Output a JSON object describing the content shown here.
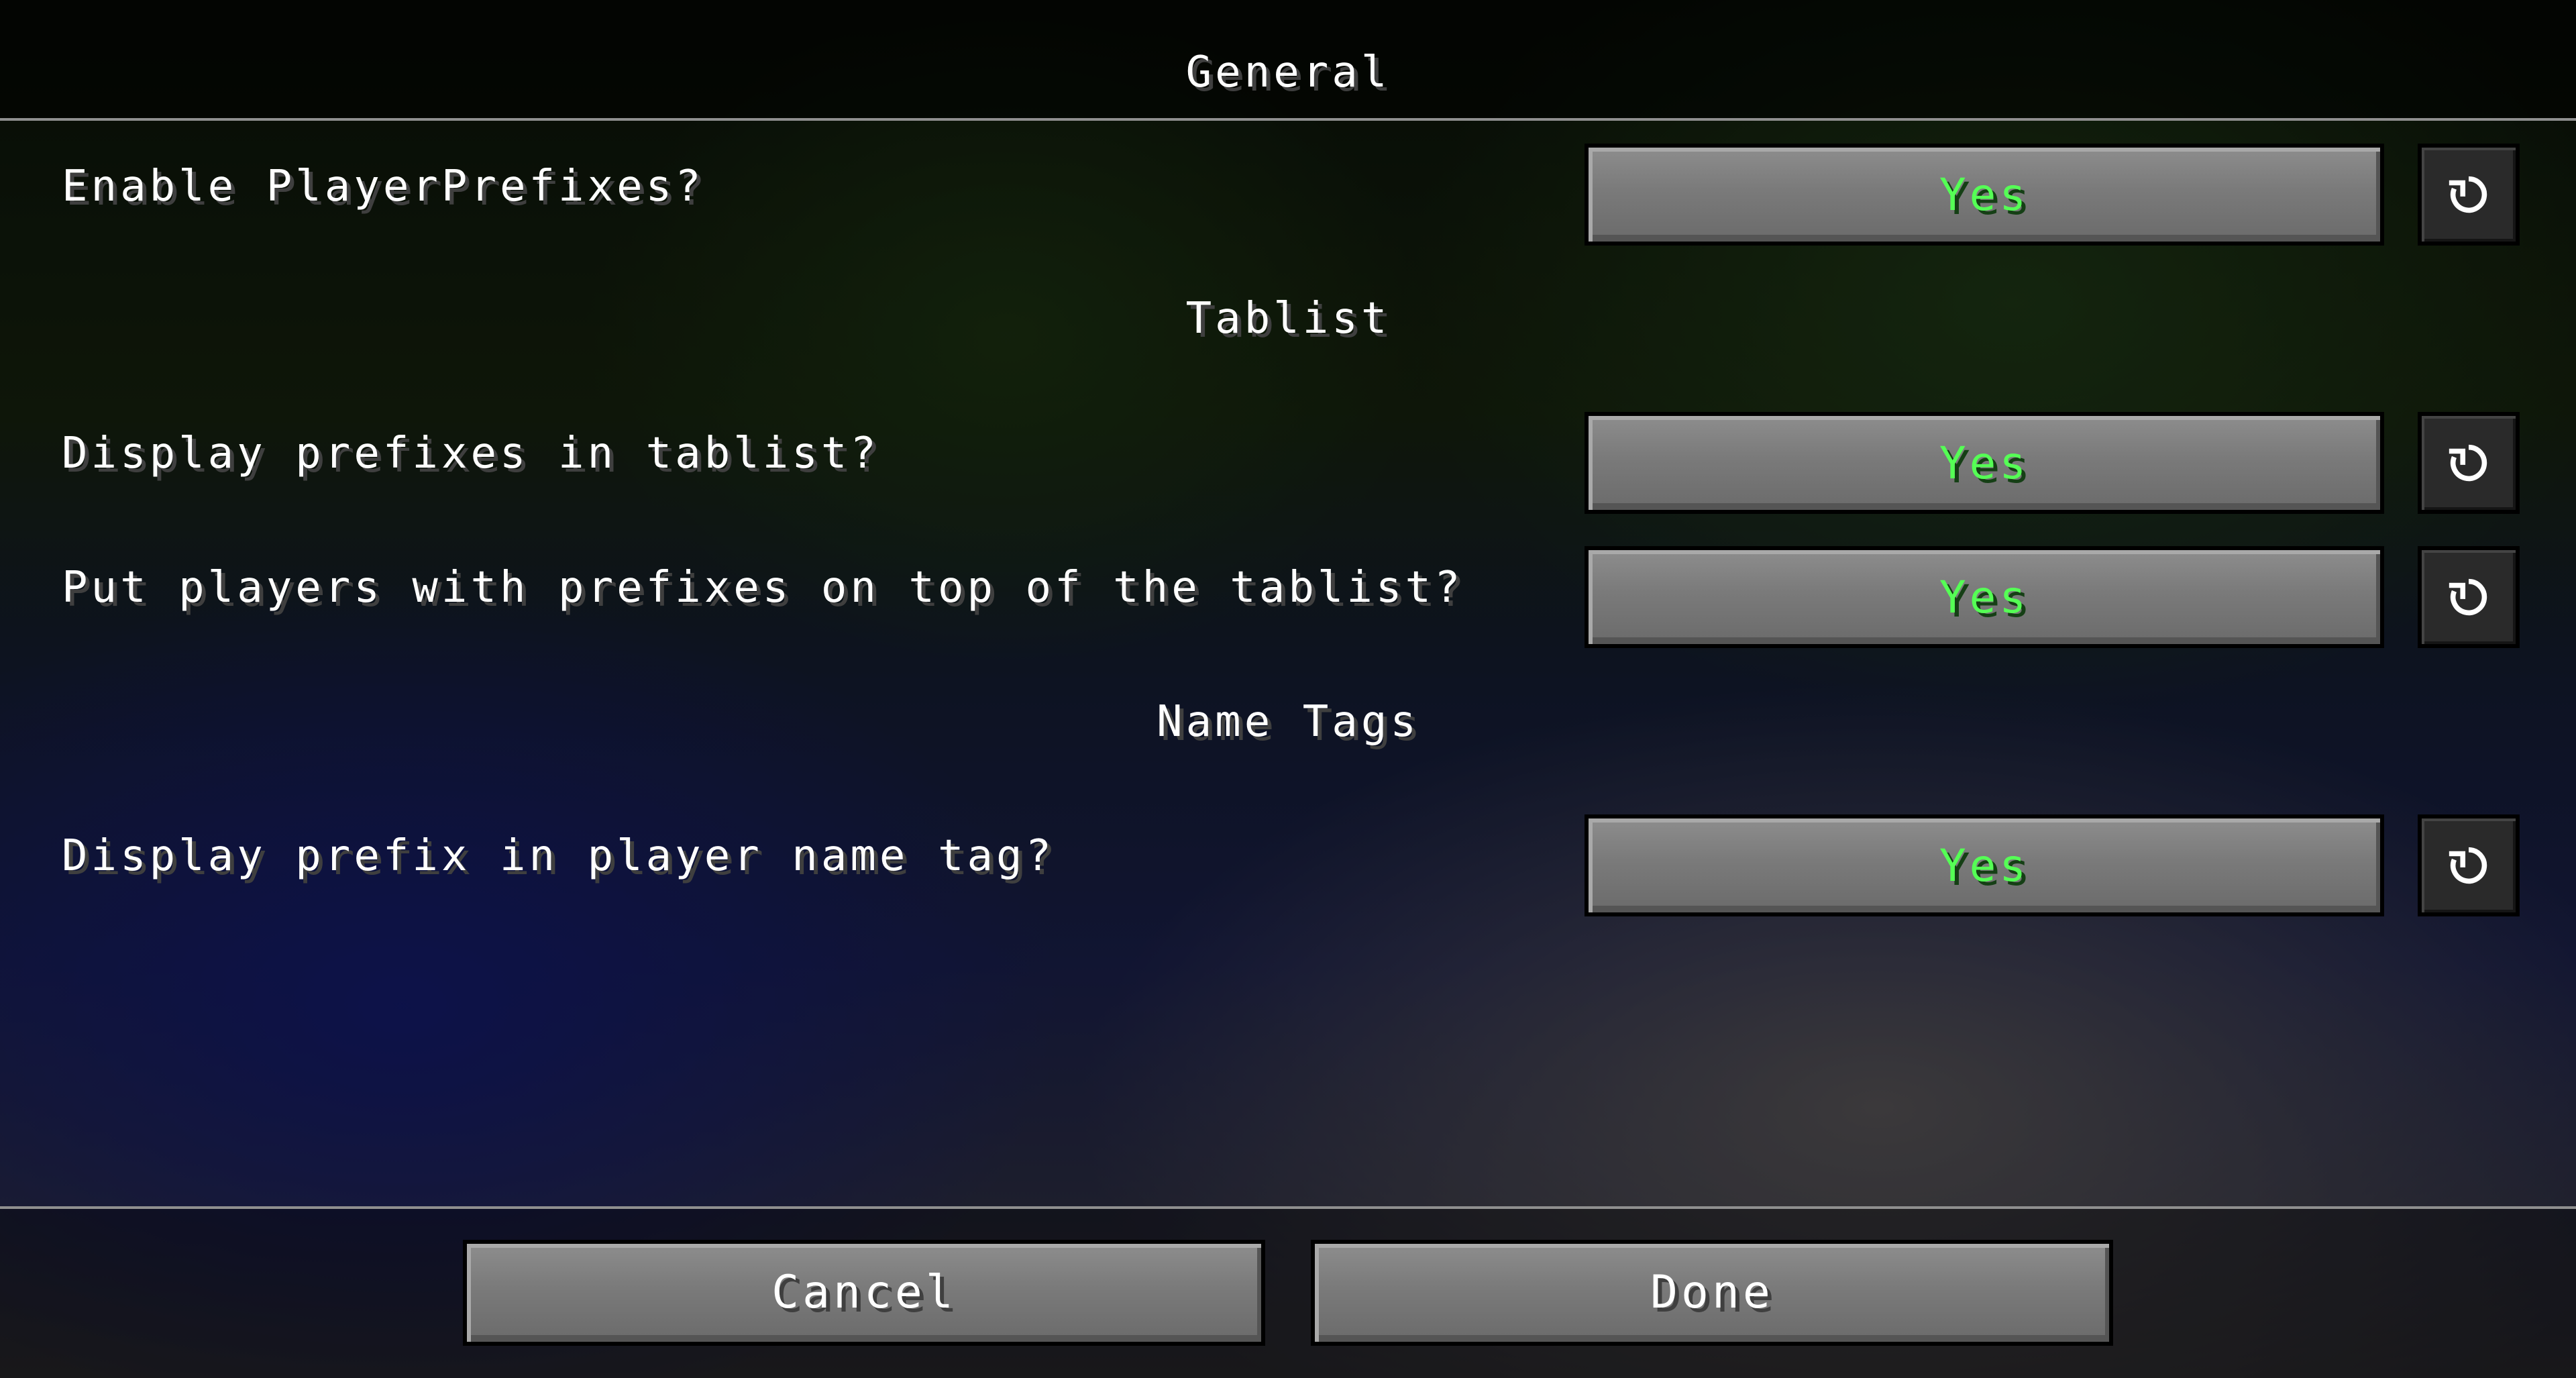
{
  "sections": {
    "general": "General",
    "tablist": "Tablist",
    "name_tags": "Name Tags"
  },
  "options": [
    {
      "label": "Enable PlayerPrefixes?",
      "value": "Yes",
      "reset_icon": "reset-icon"
    },
    {
      "label": "Display prefixes in tablist?",
      "value": "Yes",
      "reset_icon": "reset-icon"
    },
    {
      "label": "Put players with prefixes on top of the tablist?",
      "value": "Yes",
      "reset_icon": "reset-icon"
    },
    {
      "label": "Display prefix in player name tag?",
      "value": "Yes",
      "reset_icon": "reset-icon"
    }
  ],
  "footer": {
    "cancel_label": "Cancel",
    "done_label": "Done"
  },
  "colors": {
    "value_text": "#55ff55",
    "label_text": "#ffffff",
    "button_face": "#7a7a7a"
  }
}
